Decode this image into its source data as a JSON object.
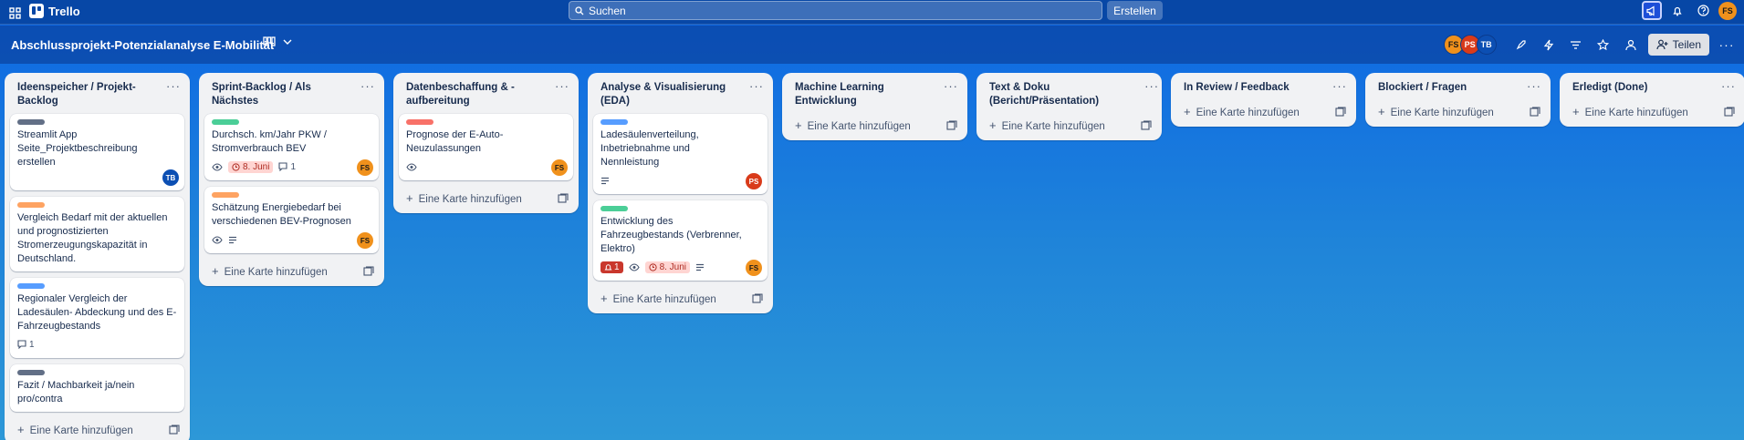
{
  "topbar": {
    "app_name": "Trello",
    "search_placeholder": "Suchen",
    "create_label": "Erstellen",
    "user_initials": "FS"
  },
  "board": {
    "title": "Abschlussprojekt-Potenzialanalyse E-Mobilität",
    "members": [
      "FS",
      "PS",
      "TB"
    ],
    "share_label": "Teilen"
  },
  "add_card_label": "Eine Karte hinzufügen",
  "colors": {
    "label_gray": "#626f86",
    "label_orange": "#fea362",
    "label_blue": "#579dff",
    "label_green": "#4bce97",
    "label_red": "#f87168"
  },
  "lists": [
    {
      "title": "Ideenspeicher / Projekt-Backlog",
      "cards": [
        {
          "label_color": "#626f86",
          "title": "Streamlit App Seite_Projektbeschreibung erstellen",
          "member": "TB"
        },
        {
          "label_color": "#fea362",
          "title": "Vergleich Bedarf mit der aktuellen und prognostizierten Stromerzeugungskapazität in Deutschland."
        },
        {
          "label_color": "#579dff",
          "title": "Regionaler Vergleich der Ladesäulen- Abdeckung und des E-Fahrzeugbestands",
          "comments": "1"
        },
        {
          "label_color": "#626f86",
          "title": "Fazit / Machbarkeit ja/nein pro/contra"
        }
      ]
    },
    {
      "title": "Sprint-Backlog / Als Nächstes",
      "cards": [
        {
          "label_color": "#4bce97",
          "title": "Durchsch. km/Jahr PKW / Stromverbrauch BEV",
          "due": "8. Juni",
          "comments": "1",
          "member": "FS"
        },
        {
          "label_color": "#fea362",
          "title": "Schätzung Energiebedarf bei verschiedenen BEV-Prognosen",
          "member": "FS"
        }
      ]
    },
    {
      "title": "Datenbeschaffung & -aufbereitung",
      "cards": [
        {
          "label_color": "#f87168",
          "title": "Prognose der E-Auto-Neuzulassungen",
          "member": "FS"
        }
      ]
    },
    {
      "title": "Analyse & Visualisierung (EDA)",
      "cards": [
        {
          "label_color": "#579dff",
          "title": "Ladesäulenverteilung, Inbetriebnahme und Nennleistung",
          "member": "PS"
        },
        {
          "label_color": "#4bce97",
          "title": "Entwicklung des Fahrzeugbestands (Verbrenner, Elektro)",
          "alert": "1",
          "due": "8. Juni",
          "member": "FS"
        }
      ]
    },
    {
      "title": "Machine Learning Entwicklung",
      "cards": []
    },
    {
      "title": "Text & Doku (Bericht/Präsentation)",
      "cards": []
    },
    {
      "title": "In Review / Feedback",
      "cards": []
    },
    {
      "title": "Blockiert / Fragen",
      "cards": []
    },
    {
      "title": "Erledigt (Done)",
      "cards": []
    }
  ]
}
